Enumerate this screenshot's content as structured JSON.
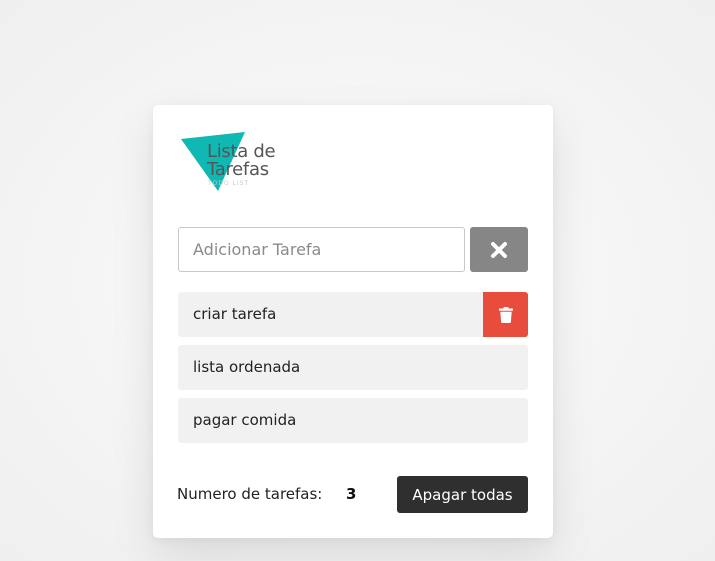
{
  "logo": {
    "line1": "Lista de",
    "line2": "Tarefas",
    "sub": "TODO LIST",
    "accent_color": "#0fb8b3"
  },
  "input": {
    "placeholder": "Adicionar Tarefa",
    "value": "",
    "clear_icon": "times-icon"
  },
  "tasks": [
    {
      "text": "criar tarefa",
      "delete_icon": "trash-icon",
      "delete_visible": true
    },
    {
      "text": "lista ordenada"
    },
    {
      "text": "pagar comida"
    }
  ],
  "footer": {
    "label": "Numero de tarefas:",
    "count": "3",
    "clear_all_label": "Apagar todas"
  },
  "colors": {
    "delete": "#e74c3c",
    "clear": "#868686",
    "dark_button": "#2f2f2f"
  }
}
